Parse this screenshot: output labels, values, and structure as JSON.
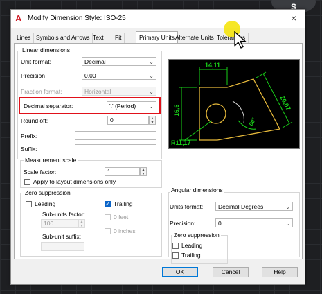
{
  "background": {
    "corner_letter": "S"
  },
  "window": {
    "title": "Modify Dimension Style: ISO-25",
    "close_glyph": "×"
  },
  "tabs": [
    {
      "label": "Lines",
      "active": false
    },
    {
      "label": "Symbols and Arrows",
      "active": false
    },
    {
      "label": "Text",
      "active": false
    },
    {
      "label": "Fit",
      "active": false
    },
    {
      "label": "Primary Units",
      "active": true
    },
    {
      "label": "Alternate Units",
      "active": false
    },
    {
      "label": "Tolerances",
      "active": false
    }
  ],
  "linear": {
    "group_label": "Linear dimensions",
    "unit_format": {
      "label": "Unit format:",
      "value": "Decimal"
    },
    "precision": {
      "label": "Precision",
      "value": "0.00"
    },
    "fraction_format": {
      "label": "Fraction format:",
      "value": "Horizontal"
    },
    "decimal_separator": {
      "label": "Decimal separator:",
      "value": "'.' (Period)"
    },
    "round_off": {
      "label": "Round off:",
      "value": "0"
    },
    "prefix": {
      "label": "Prefix:",
      "value": ""
    },
    "suffix": {
      "label": "Suffix:",
      "value": ""
    }
  },
  "measurement": {
    "group_label": "Measurement scale",
    "scale_factor": {
      "label": "Scale factor:",
      "value": "1"
    },
    "apply_layout": {
      "label": "Apply to layout dimensions only",
      "checked": false
    }
  },
  "zero_suppression": {
    "group_label": "Zero suppression",
    "leading": {
      "label": "Leading",
      "checked": false
    },
    "trailing": {
      "label": "Trailing",
      "checked": true
    },
    "sub_units_factor": {
      "label": "Sub-units factor:",
      "value": "100"
    },
    "zero_feet": {
      "label": "0 feet",
      "checked": false
    },
    "zero_inches": {
      "label": "0 inches",
      "checked": false
    },
    "sub_unit_suffix": {
      "label": "Sub-unit suffix:",
      "value": ""
    }
  },
  "preview": {
    "dim_top": "14,11",
    "dim_left": "16,6",
    "dim_diag": "20,07",
    "dim_angle": "60°",
    "dim_radius": "R11,17",
    "colors": {
      "geometry": "#e5b83a",
      "dimension": "#19d219",
      "arc": "#cfcfcf"
    }
  },
  "angular": {
    "group_label": "Angular dimensions",
    "units_format": {
      "label": "Units format:",
      "value": "Decimal Degrees"
    },
    "precision": {
      "label": "Precision:",
      "value": "0"
    },
    "zero_suppression": {
      "group_label": "Zero suppression",
      "leading": {
        "label": "Leading",
        "checked": false
      },
      "trailing": {
        "label": "Trailing",
        "checked": false
      }
    }
  },
  "buttons": {
    "ok": "OK",
    "cancel": "Cancel",
    "help": "Help"
  },
  "accent": {
    "highlight_box": "#e0111a",
    "cursor_halo": "#f4e300"
  }
}
